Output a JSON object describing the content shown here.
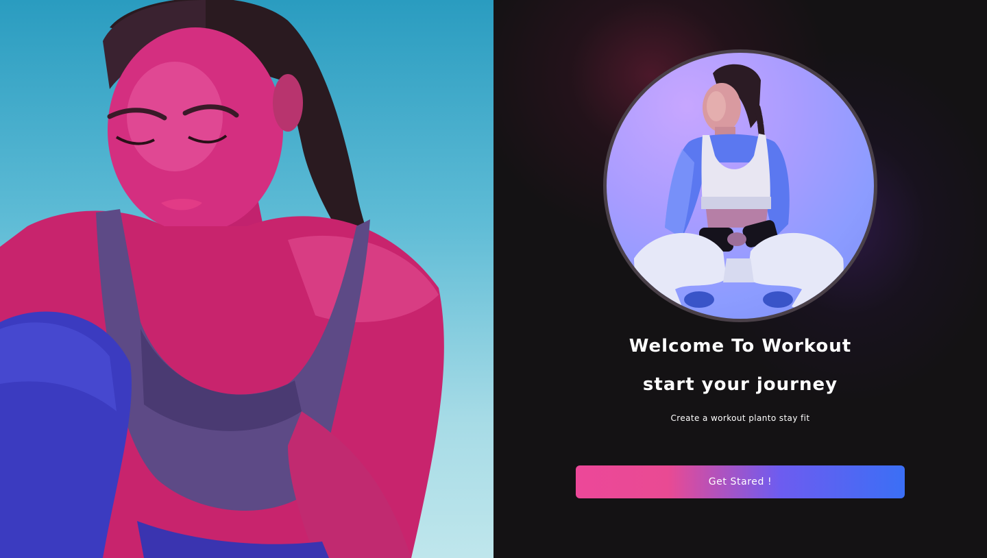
{
  "hero": {
    "image_icon": "person-photo-icon"
  },
  "onboarding": {
    "avatar_icon": "athlete-photo-icon",
    "title": "Welcome To Workout",
    "heading": "start your journey",
    "subtitle": "Create a workout planto stay fit",
    "cta_label": "Get Stared !"
  },
  "colors": {
    "background": "#141214",
    "accent_start": "#ec4899",
    "accent_end": "#3b6ff5",
    "text": "#ffffff",
    "circle_border": "#4a4048"
  }
}
